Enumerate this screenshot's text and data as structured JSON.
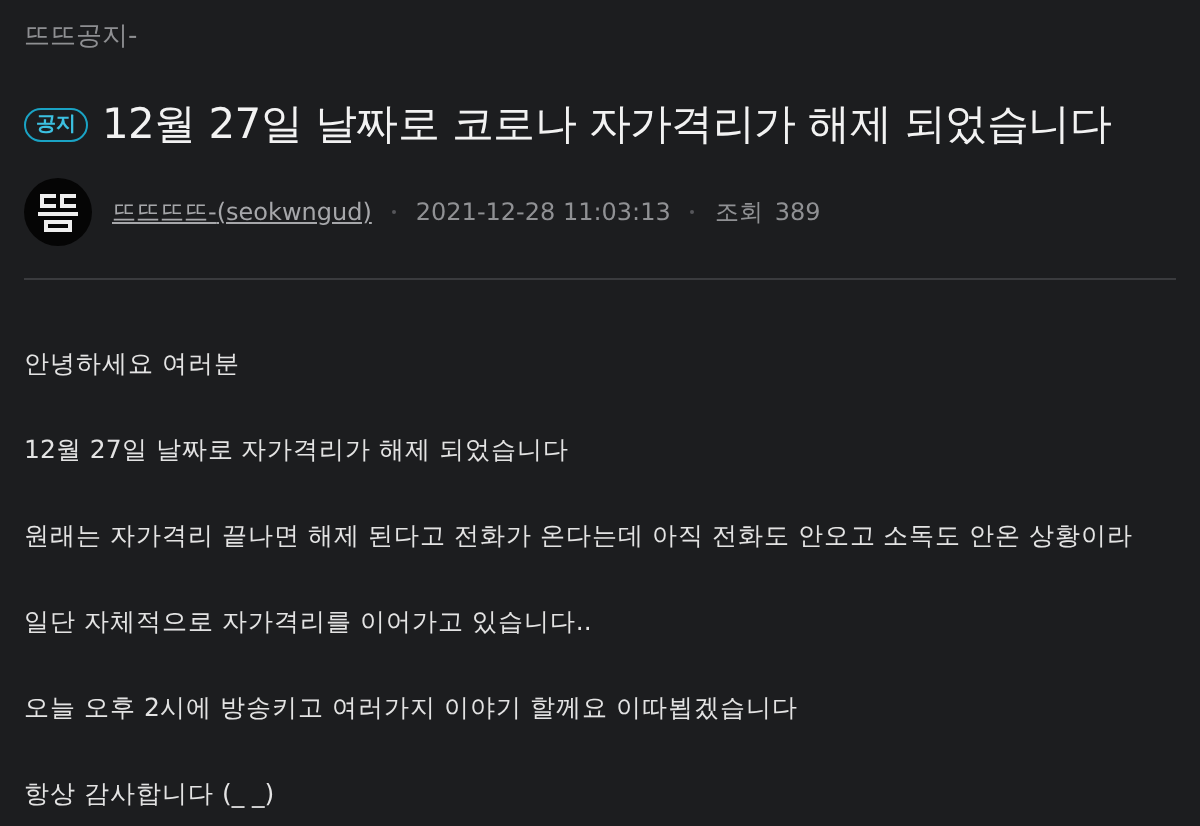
{
  "board": {
    "category": "뜨뜨공지-"
  },
  "post": {
    "badge": "공지",
    "title": "12월 27일 날짜로 코로나 자가격리가 해제 되었습니다",
    "author": {
      "nickname": "뜨뜨뜨뜨-",
      "id": "(seokwngud)"
    },
    "date": "2021-12-28 11:03:13",
    "views_label": "조회",
    "views": "389"
  },
  "paragraphs": [
    "안녕하세요 여러분",
    "12월 27일 날짜로 자가격리가 해제 되었습니다",
    "원래는 자가격리 끝나면 해제 된다고 전화가 온다는데 아직 전화도 안오고 소독도 안온 상황이라",
    "일단 자체적으로 자가격리를 이어가고 있습니다..",
    "오늘 오후 2시에 방송키고 여러가지 이야기 할께요 이따뵙겠습니다",
    "항상 감사합니다 (_ _)"
  ]
}
